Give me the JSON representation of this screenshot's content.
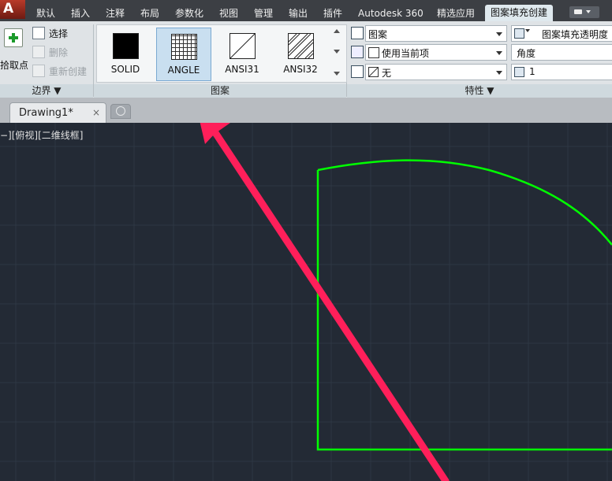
{
  "app": {
    "logo_letter": "A"
  },
  "ribbon_tabs": [
    "默认",
    "插入",
    "注释",
    "布局",
    "参数化",
    "视图",
    "管理",
    "输出",
    "插件",
    "Autodesk 360",
    "精选应用",
    "图案填充创建"
  ],
  "boundary_panel": {
    "pick_points": "拾取点",
    "select": "选择",
    "remove": "删除",
    "recreate": "重新创建",
    "title": "边界 ▼"
  },
  "pattern_panel": {
    "patterns": [
      "SOLID",
      "ANGLE",
      "ANSI31",
      "ANSI32"
    ],
    "selected": "ANGLE",
    "title": "图案"
  },
  "properties_panel": {
    "hatch_type": "图案",
    "hatch_color": "使用当前项",
    "background_color": "无",
    "transparency_label": "图案填充透明度",
    "angle_label": "角度",
    "scale_value": "1",
    "title": "特性 ▼"
  },
  "document": {
    "tab_name": "Drawing1*",
    "close_glyph": "×"
  },
  "viewport": {
    "label": "−][俯视][二维线框]"
  },
  "colors": {
    "canvas_bg": "#232a35",
    "outline": "#00ff00",
    "arrow": "#ff1f5a",
    "grid": "#2e3744"
  }
}
